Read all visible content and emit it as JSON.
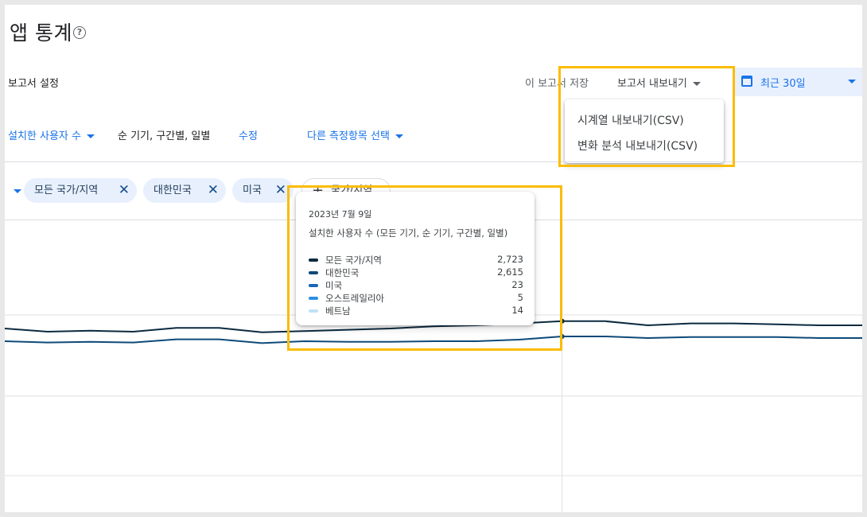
{
  "page": {
    "title": "앱 통계",
    "help_icon": "help-circle-icon"
  },
  "toolbar": {
    "report_settings": "보고서 설정",
    "save_report": "이 보고서 저장",
    "export_report": "보고서 내보내기",
    "date_range": "최근 30일"
  },
  "export_menu": {
    "items": [
      {
        "label": "시계열 내보내기(CSV)"
      },
      {
        "label": "변화 분석 내보내기(CSV)"
      }
    ]
  },
  "metrics": {
    "primary": "설치한 사용자 수",
    "sub": "순 기기, 구간별, 일별",
    "edit": "수정",
    "other": "다른 측정항목 선택"
  },
  "filters": {
    "chips": [
      {
        "label": "모든 국가/지역"
      },
      {
        "label": "대한민국"
      },
      {
        "label": "미국"
      }
    ],
    "add_label": "국가/지역"
  },
  "tooltip": {
    "date": "2023년 7월 9일",
    "metric": "설치한 사용자 수 (모든 기기, 순 기기, 구간별, 일별)",
    "rows": [
      {
        "name": "모든 국가/지역",
        "value": "2,723",
        "color": "#0b2a40"
      },
      {
        "name": "대한민국",
        "value": "2,615",
        "color": "#0d4a7a"
      },
      {
        "name": "미국",
        "value": "23",
        "color": "#1967b5"
      },
      {
        "name": "오스트레일리아",
        "value": "5",
        "color": "#2e8fe0"
      },
      {
        "name": "베트남",
        "value": "14",
        "color": "#bfe0f7"
      }
    ]
  },
  "chart_data": {
    "type": "line",
    "title": "",
    "xlabel": "",
    "ylabel": "",
    "point_count": 21,
    "highlight_index": 13,
    "grid": true,
    "series": [
      {
        "name": "모든 국가/지역",
        "color": "#0b2a40",
        "values": [
          2700,
          2690,
          2693,
          2690,
          2702,
          2702,
          2688,
          2692,
          2696,
          2700,
          2707,
          2710,
          2716,
          2723,
          2723,
          2710,
          2716,
          2716,
          2713,
          2710,
          2710
        ]
      },
      {
        "name": "대한민국",
        "color": "#0d4a7a",
        "values": [
          2600,
          2596,
          2598,
          2596,
          2606,
          2606,
          2594,
          2600,
          2598,
          2598,
          2600,
          2600,
          2605,
          2615,
          2615,
          2610,
          2613,
          2613,
          2613,
          2610,
          2610
        ]
      },
      {
        "name": "미국",
        "color": "#1967b5",
        "values": []
      },
      {
        "name": "오스트레일리아",
        "color": "#2e8fe0",
        "values": []
      },
      {
        "name": "베트남",
        "color": "#bfe0f7",
        "values": []
      }
    ]
  },
  "colors": {
    "accent": "#1a73e8",
    "chip_bg": "#e8f0fe",
    "highlight_box": "#fbbc04"
  }
}
